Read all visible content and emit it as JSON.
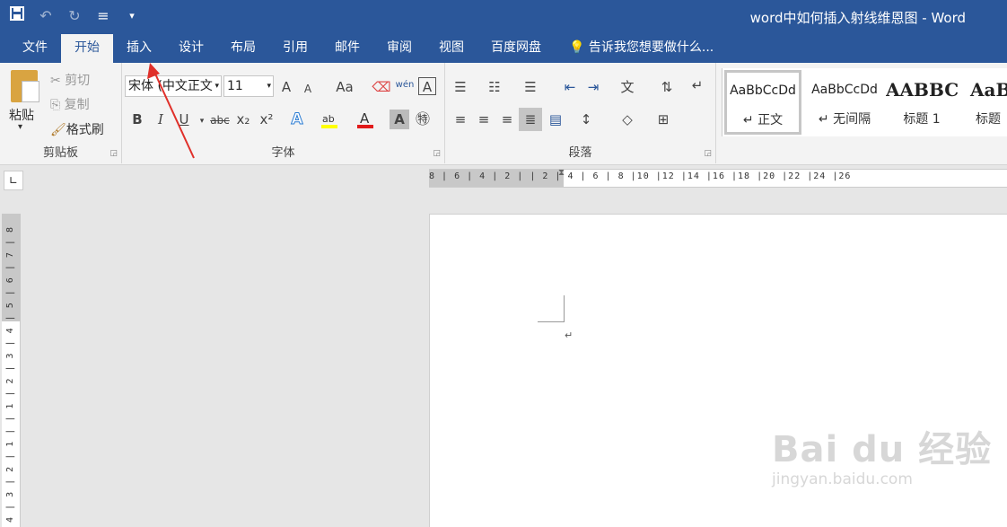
{
  "qat": {
    "save_icon": "save-icon",
    "undo_icon": "undo-icon",
    "redo_icon": "redo-icon",
    "touch_icon": "touch-mode-icon",
    "customize_icon": "customize-qat-icon"
  },
  "window": {
    "title": "word中如何插入射线维恩图 - Word"
  },
  "tabs": [
    {
      "label": "文件"
    },
    {
      "label": "开始"
    },
    {
      "label": "插入"
    },
    {
      "label": "设计"
    },
    {
      "label": "布局"
    },
    {
      "label": "引用"
    },
    {
      "label": "邮件"
    },
    {
      "label": "审阅"
    },
    {
      "label": "视图"
    },
    {
      "label": "百度网盘"
    }
  ],
  "active_tab": "开始",
  "tell_me": "告诉我您想要做什么...",
  "clipboard": {
    "paste": "粘贴",
    "cut": "剪切",
    "copy": "复制",
    "format_painter": "格式刷",
    "group_label": "剪贴板"
  },
  "font": {
    "name": "宋体 (中文正文",
    "size": "11",
    "group_label": "字体",
    "bold": "B",
    "italic": "I",
    "underline": "U",
    "strike": "abc",
    "subscript": "x₂",
    "superscript": "x²",
    "grow": "A",
    "shrink": "A",
    "change_case": "Aa",
    "phonetic": "wén",
    "highlight_color": "#ffff00",
    "font_color": "#e11a1a"
  },
  "paragraph": {
    "group_label": "段落"
  },
  "styles": [
    {
      "preview": "AaBbCcDd",
      "name": "↵ 正文"
    },
    {
      "preview": "AaBbCcDd",
      "name": "↵ 无间隔"
    },
    {
      "preview": "AABBC",
      "name": "标题 1"
    },
    {
      "preview": "AaB",
      "name": "标题"
    }
  ],
  "ruler_h": "8 | 6 | 4 | 2 |   | 2 | 4 | 6 | 8 |10 |12 |14 |16 |18 |20 |22 |24 |26",
  "ruler_v": "4 | 3 | 2 | 1 |   | 1 | 2 | 3 | 4 | 5 | 6 | 7 | 8",
  "document": {
    "paragraph_mark": "↵"
  },
  "watermark": {
    "logo": "Bai du 经验",
    "url": "jingyan.baidu.com"
  },
  "colors": {
    "ribbon_blue": "#2b579a",
    "arrow_red": "#e0302a"
  }
}
